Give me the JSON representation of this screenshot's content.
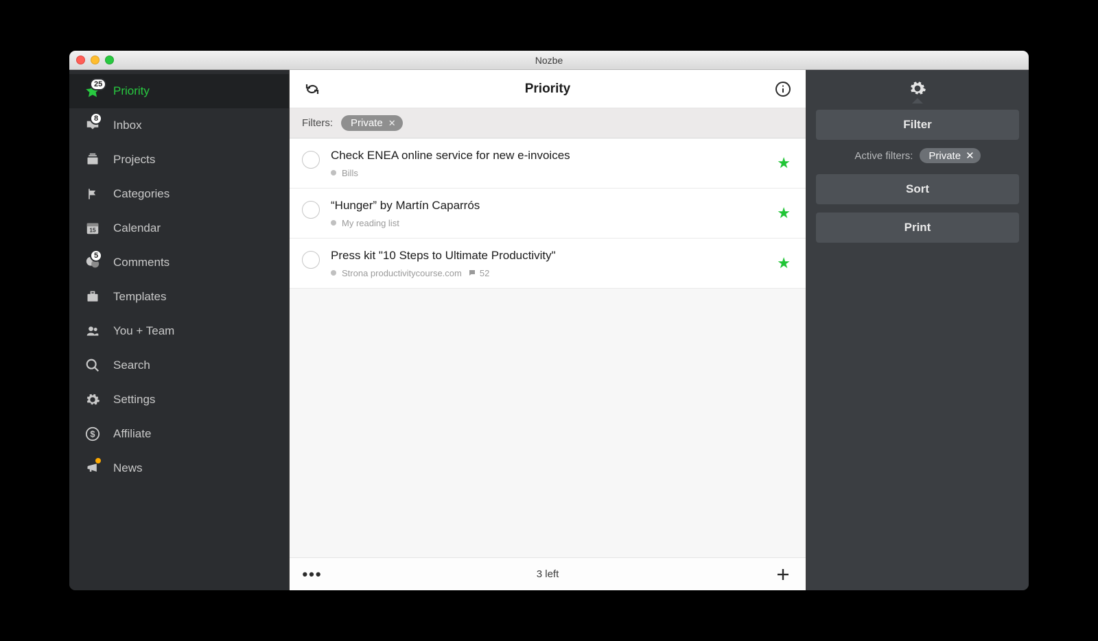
{
  "window": {
    "title": "Nozbe"
  },
  "sidebar": {
    "items": [
      {
        "id": "priority",
        "label": "Priority",
        "badge": "25",
        "active": true
      },
      {
        "id": "inbox",
        "label": "Inbox",
        "badge": "8"
      },
      {
        "id": "projects",
        "label": "Projects"
      },
      {
        "id": "categories",
        "label": "Categories"
      },
      {
        "id": "calendar",
        "label": "Calendar",
        "calday": "15"
      },
      {
        "id": "comments",
        "label": "Comments",
        "badge": "5"
      },
      {
        "id": "templates",
        "label": "Templates"
      },
      {
        "id": "team",
        "label": "You + Team"
      },
      {
        "id": "search",
        "label": "Search"
      },
      {
        "id": "settings",
        "label": "Settings"
      },
      {
        "id": "affiliate",
        "label": "Affiliate"
      },
      {
        "id": "news",
        "label": "News",
        "dot": true
      }
    ]
  },
  "main": {
    "title": "Priority",
    "filters_label": "Filters:",
    "filter_chip": "Private",
    "tasks": [
      {
        "title": "Check ENEA online service for new e-invoices",
        "project": "Bills"
      },
      {
        "title": "“Hunger” by Martín Caparrós",
        "project": "My reading list"
      },
      {
        "title": "Press kit \"10 Steps to Ultimate Productivity\"",
        "project": "Strona productivitycourse.com",
        "comments": "52"
      }
    ],
    "footer": "3 left"
  },
  "right": {
    "filter_btn": "Filter",
    "active_filters_label": "Active filters:",
    "active_filter_chip": "Private",
    "sort_btn": "Sort",
    "print_btn": "Print"
  }
}
